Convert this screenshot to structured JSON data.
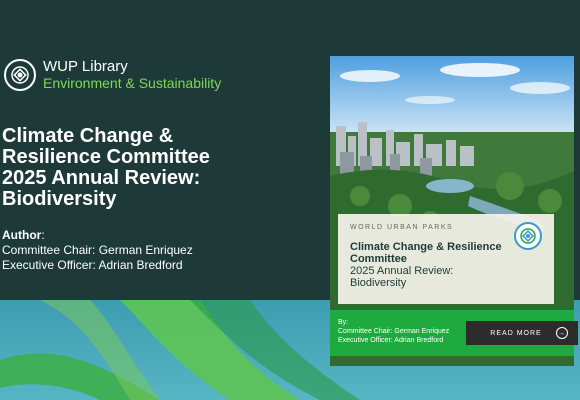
{
  "library": {
    "name": "WUP Library",
    "section": "Environment & Sustainability"
  },
  "document": {
    "title_lines": [
      "Climate Change &",
      "Resilience Committee",
      "2025 Annual Review:",
      "Biodiversity"
    ],
    "author_label": "Author",
    "author_colon": ":",
    "authors": [
      "Committee Chair: German Enriquez",
      "Executive Officer: Adrian Bredford"
    ]
  },
  "cover": {
    "brand": "WORLD URBAN PARKS",
    "title_lines": [
      "Climate Change & Resilience",
      "Committee"
    ],
    "subtitle_lines": [
      "2025 Annual Review:",
      "Biodiversity"
    ],
    "by_label": "By:",
    "by_lines": [
      "Committee Chair: German Enriquez",
      "Executive Officer: Adrian Bredford"
    ],
    "read_more_label": "READ MORE",
    "read_more_icon": "arrow-right-circle-icon"
  },
  "colors": {
    "background": "#1d3a38",
    "accent_green": "#7ed957",
    "cover_green": "#1faa3f",
    "band_blue": "#4fb0c0"
  }
}
